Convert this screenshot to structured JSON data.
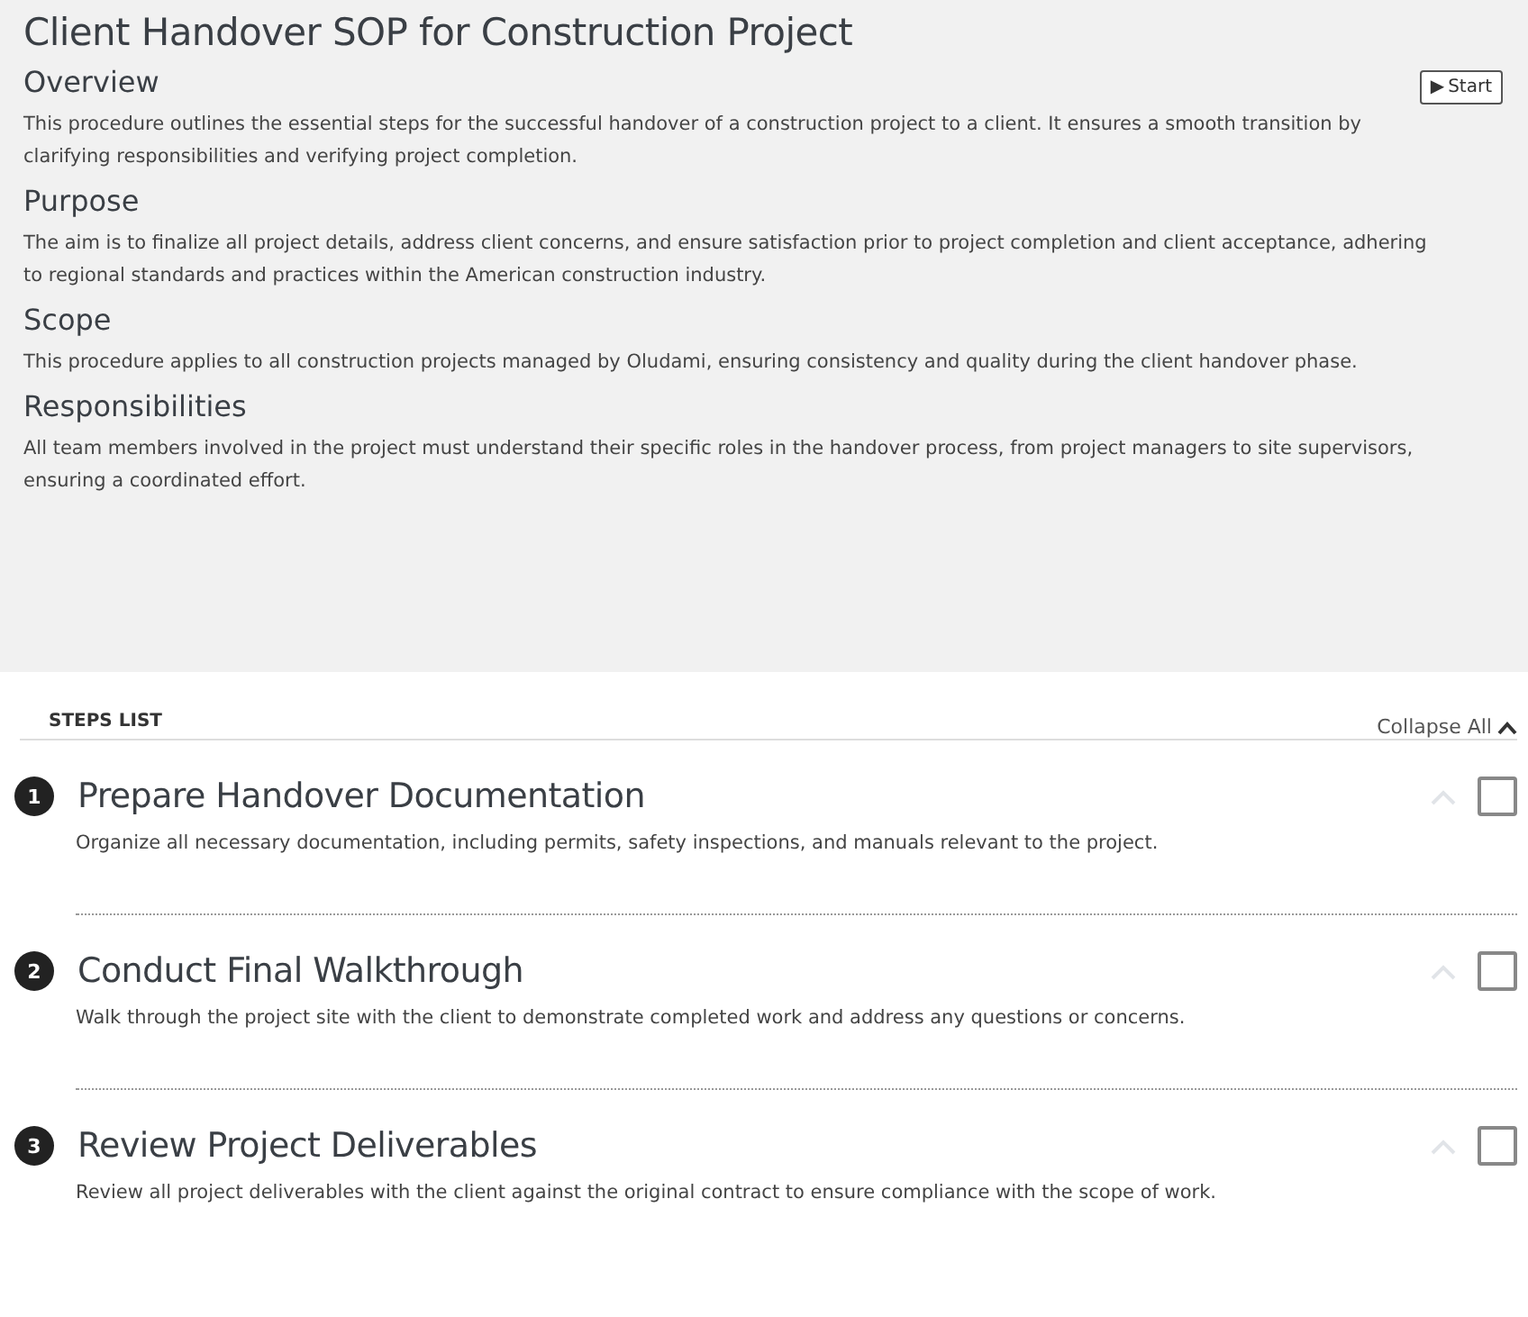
{
  "title": "Client Handover SOP for Construction Project",
  "start_button": {
    "icon": "▶",
    "label": "Start"
  },
  "sections": [
    {
      "heading": "Overview",
      "text": "This procedure outlines the essential steps for the successful handover of a construction project to a client. It ensures a smooth transition by clarifying responsibilities and verifying project completion."
    },
    {
      "heading": "Purpose",
      "text": "The aim is to finalize all project details, address client concerns, and ensure satisfaction prior to project completion and client acceptance, adhering to regional standards and practices within the American construction industry."
    },
    {
      "heading": "Scope",
      "text": "This procedure applies to all construction projects managed by Oludami, ensuring consistency and quality during the client handover phase."
    },
    {
      "heading": "Responsibilities",
      "text": "All team members involved in the project must understand their specific roles in the handover process, from project managers to site supervisors, ensuring a coordinated effort."
    }
  ],
  "steps_list": {
    "label": "STEPS LIST",
    "collapse": "Collapse All",
    "steps": [
      {
        "number": "1",
        "title": "Prepare Handover Documentation",
        "description": "Organize all necessary documentation, including permits, safety inspections, and manuals relevant to the project.",
        "checked": false
      },
      {
        "number": "2",
        "title": "Conduct Final Walkthrough",
        "description": "Walk through the project site with the client to demonstrate completed work and address any questions or concerns.",
        "checked": false
      },
      {
        "number": "3",
        "title": "Review Project Deliverables",
        "description": "Review all project deliverables with the client against the original contract to ensure compliance with the scope of work.",
        "checked": false
      }
    ]
  }
}
